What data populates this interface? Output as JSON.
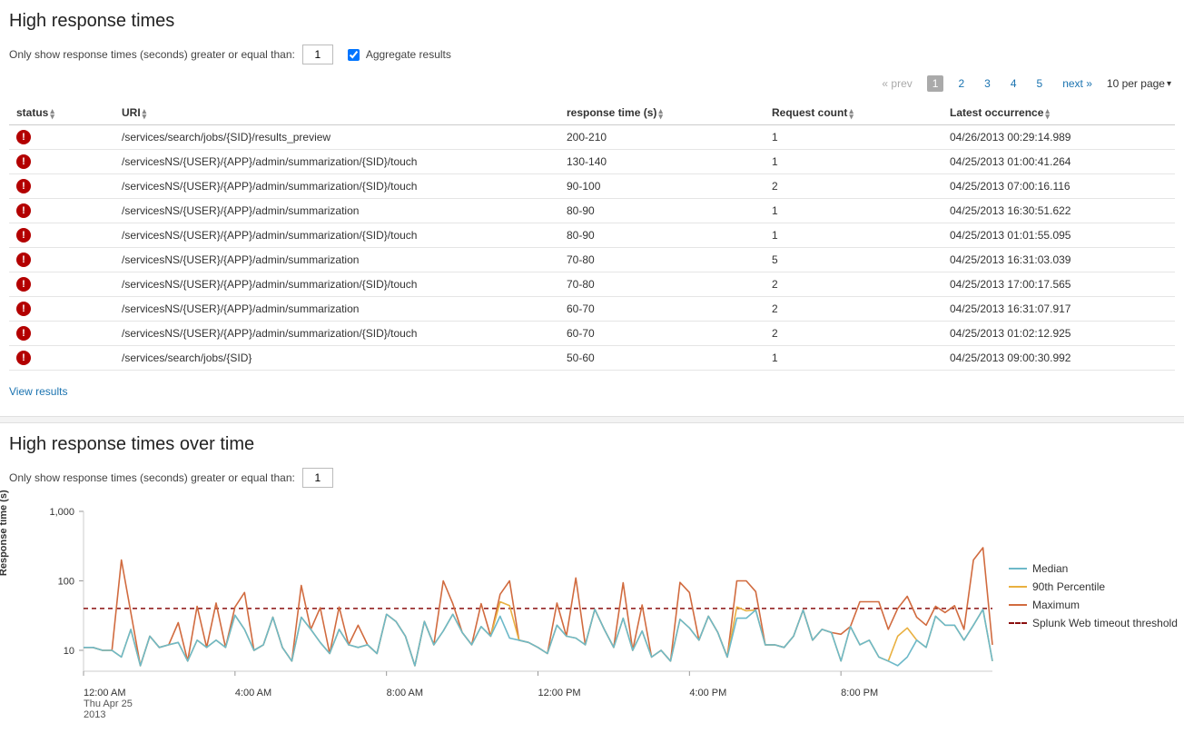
{
  "panel1": {
    "title": "High response times",
    "filter_label": "Only show response times (seconds) greater or equal than:",
    "filter_value": "1",
    "aggregate_label": "Aggregate results",
    "aggregate_checked": true,
    "paginator": {
      "prev": "« prev",
      "pages": [
        "1",
        "2",
        "3",
        "4",
        "5"
      ],
      "current": "1",
      "next": "next »",
      "per_page": "10 per page"
    },
    "columns": {
      "status": "status",
      "uri": "URI",
      "rt": "response time (s)",
      "rc": "Request count",
      "lo": "Latest occurrence"
    },
    "rows": [
      {
        "uri": "/services/search/jobs/{SID}/results_preview",
        "rt": "200-210",
        "rc": "1",
        "lo": "04/26/2013 00:29:14.989"
      },
      {
        "uri": "/servicesNS/{USER}/{APP}/admin/summarization/{SID}/touch",
        "rt": "130-140",
        "rc": "1",
        "lo": "04/25/2013 01:00:41.264"
      },
      {
        "uri": "/servicesNS/{USER}/{APP}/admin/summarization/{SID}/touch",
        "rt": "90-100",
        "rc": "2",
        "lo": "04/25/2013 07:00:16.116"
      },
      {
        "uri": "/servicesNS/{USER}/{APP}/admin/summarization",
        "rt": "80-90",
        "rc": "1",
        "lo": "04/25/2013 16:30:51.622"
      },
      {
        "uri": "/servicesNS/{USER}/{APP}/admin/summarization/{SID}/touch",
        "rt": "80-90",
        "rc": "1",
        "lo": "04/25/2013 01:01:55.095"
      },
      {
        "uri": "/servicesNS/{USER}/{APP}/admin/summarization",
        "rt": "70-80",
        "rc": "5",
        "lo": "04/25/2013 16:31:03.039"
      },
      {
        "uri": "/servicesNS/{USER}/{APP}/admin/summarization/{SID}/touch",
        "rt": "70-80",
        "rc": "2",
        "lo": "04/25/2013 17:00:17.565"
      },
      {
        "uri": "/servicesNS/{USER}/{APP}/admin/summarization",
        "rt": "60-70",
        "rc": "2",
        "lo": "04/25/2013 16:31:07.917"
      },
      {
        "uri": "/servicesNS/{USER}/{APP}/admin/summarization/{SID}/touch",
        "rt": "60-70",
        "rc": "2",
        "lo": "04/25/2013 01:02:12.925"
      },
      {
        "uri": "/services/search/jobs/{SID}",
        "rt": "50-60",
        "rc": "1",
        "lo": "04/25/2013 09:00:30.992"
      }
    ],
    "view_results": "View results"
  },
  "panel2": {
    "title": "High response times over time",
    "filter_label": "Only show response times (seconds) greater or equal than:",
    "filter_value": "1"
  },
  "chart_data": {
    "type": "line",
    "ylabel": "Response time (s)",
    "yscale": "log",
    "ylim": [
      5,
      1000
    ],
    "yticks": [
      10,
      100,
      1000
    ],
    "threshold": 40,
    "x_ticks": [
      "12:00 AM",
      "4:00 AM",
      "8:00 AM",
      "12:00 PM",
      "4:00 PM",
      "8:00 PM"
    ],
    "x_sub": [
      "Thu Apr 25",
      "2013"
    ],
    "n_points": 97,
    "legend": {
      "median": "Median",
      "p90": "90th Percentile",
      "max": "Maximum",
      "threshold": "Splunk Web timeout threshold"
    },
    "colors": {
      "median": "#6db9c9",
      "p90": "#e9b040",
      "max": "#d16b3f",
      "threshold": "#8a0f0f"
    },
    "series": {
      "median": [
        11,
        11,
        10,
        10,
        8,
        20,
        6,
        16,
        11,
        12,
        13,
        7,
        14,
        11,
        14,
        11,
        32,
        20,
        10,
        12,
        30,
        11,
        7,
        30,
        20,
        13,
        9,
        20,
        12,
        11,
        12,
        9,
        33,
        26,
        16,
        6,
        26,
        12,
        19,
        33,
        18,
        12,
        22,
        16,
        31,
        15,
        14,
        13,
        11,
        9,
        23,
        16,
        15,
        12,
        39,
        20,
        11,
        29,
        10,
        19,
        8,
        10,
        7,
        28,
        21,
        14,
        31,
        18,
        8,
        29,
        29,
        38,
        12,
        12,
        11,
        16,
        38,
        14,
        20,
        18,
        7,
        22,
        12,
        14,
        8,
        7,
        6,
        8,
        14,
        11,
        31,
        23,
        23,
        14,
        23,
        39,
        7
      ],
      "p90": [
        11,
        11,
        10,
        10,
        8,
        20,
        6,
        16,
        11,
        12,
        13,
        7,
        14,
        11,
        14,
        11,
        32,
        20,
        10,
        12,
        30,
        11,
        7,
        30,
        20,
        13,
        9,
        20,
        12,
        11,
        12,
        9,
        33,
        26,
        16,
        6,
        26,
        12,
        19,
        33,
        18,
        12,
        22,
        16,
        50,
        44,
        14,
        13,
        11,
        9,
        23,
        16,
        15,
        12,
        39,
        20,
        11,
        29,
        10,
        19,
        8,
        10,
        7,
        28,
        21,
        14,
        31,
        18,
        8,
        42,
        37,
        38,
        12,
        12,
        11,
        16,
        38,
        14,
        20,
        18,
        7,
        22,
        12,
        14,
        8,
        7,
        16,
        21,
        14,
        11,
        31,
        23,
        23,
        14,
        23,
        39,
        7
      ],
      "max": [
        11,
        11,
        10,
        10,
        200,
        35,
        6,
        16,
        11,
        12,
        25,
        7,
        43,
        11,
        48,
        11,
        42,
        68,
        10,
        12,
        30,
        11,
        7,
        86,
        20,
        41,
        9,
        42,
        12,
        23,
        12,
        9,
        33,
        26,
        16,
        6,
        26,
        12,
        100,
        47,
        18,
        12,
        47,
        16,
        64,
        100,
        14,
        13,
        11,
        9,
        48,
        16,
        110,
        12,
        39,
        20,
        11,
        94,
        10,
        45,
        8,
        10,
        7,
        95,
        68,
        14,
        31,
        18,
        8,
        100,
        100,
        70,
        12,
        12,
        11,
        16,
        38,
        14,
        20,
        18,
        17,
        22,
        50,
        50,
        50,
        20,
        40,
        60,
        30,
        23,
        43,
        35,
        44,
        20,
        200,
        300,
        12
      ]
    }
  }
}
